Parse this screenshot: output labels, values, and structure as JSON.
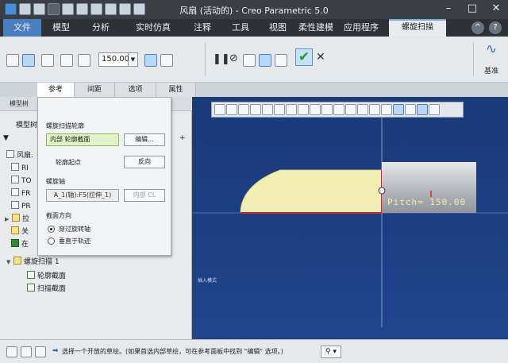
{
  "window": {
    "title": "风扇 (活动的) - Creo Parametric 5.0",
    "controls": [
      "–",
      "□",
      "✕"
    ]
  },
  "menu": {
    "tabs": [
      "文件",
      "模型",
      "分析",
      "实时仿真",
      "注释",
      "工具",
      "视图",
      "柔性建模",
      "应用程序"
    ],
    "active_tab": "螺旋扫描",
    "help_glyph": "?"
  },
  "ribbon": {
    "pitch_value": "150.00",
    "pitch_dropdown_glyph": "▼",
    "pause_glyph": "❚❚",
    "stop_glyph": "⊘",
    "ok_glyph": "✔",
    "cancel_glyph": "✕",
    "datum_icon": "wave-icon",
    "datum_label": "基准"
  },
  "subtabs": [
    "参考",
    "间距",
    "选项",
    "属性"
  ],
  "active_subtab": "参考",
  "ref_panel": {
    "sweep_profile_label": "螺旋扫描轮廓",
    "sweep_profile_value": "内部 轮廓截面",
    "edit_button": "编辑...",
    "profile_start_label": "轮廓起点",
    "reverse_button": "反向",
    "helix_axis_label": "螺旋轴",
    "helix_axis_value": "A_1(轴):F5(拉伸_1)",
    "internal_cl_button": "内部 CL",
    "section_orientation_label": "截面方向",
    "options": [
      {
        "label": "穿过旋转轴",
        "selected": true
      },
      {
        "label": "垂直于轨迹",
        "selected": false
      }
    ]
  },
  "model_tree": {
    "header": "模型树",
    "visible_rows": [
      {
        "label": "风扇.",
        "type": "part"
      },
      {
        "label": "RI",
        "type": "plane"
      },
      {
        "label": "TO",
        "type": "plane"
      },
      {
        "label": "FR",
        "type": "plane"
      },
      {
        "label": "PR",
        "type": "csys"
      },
      {
        "label": "拉",
        "type": "feature"
      },
      {
        "label": "关",
        "type": "feature"
      },
      {
        "label": "在",
        "type": "insert"
      }
    ],
    "feature": {
      "label": "螺旋扫描 1",
      "children": [
        "轮廓截面",
        "扫描截面"
      ]
    }
  },
  "graphics": {
    "mode_label": "插入模式",
    "pitch_annotation": "Pitch= 150.00"
  },
  "status": {
    "message": "选择一个开放的草绘。(如果首选内部草绘，可在参考面板中找到 \"编辑\" 选项。)"
  }
}
